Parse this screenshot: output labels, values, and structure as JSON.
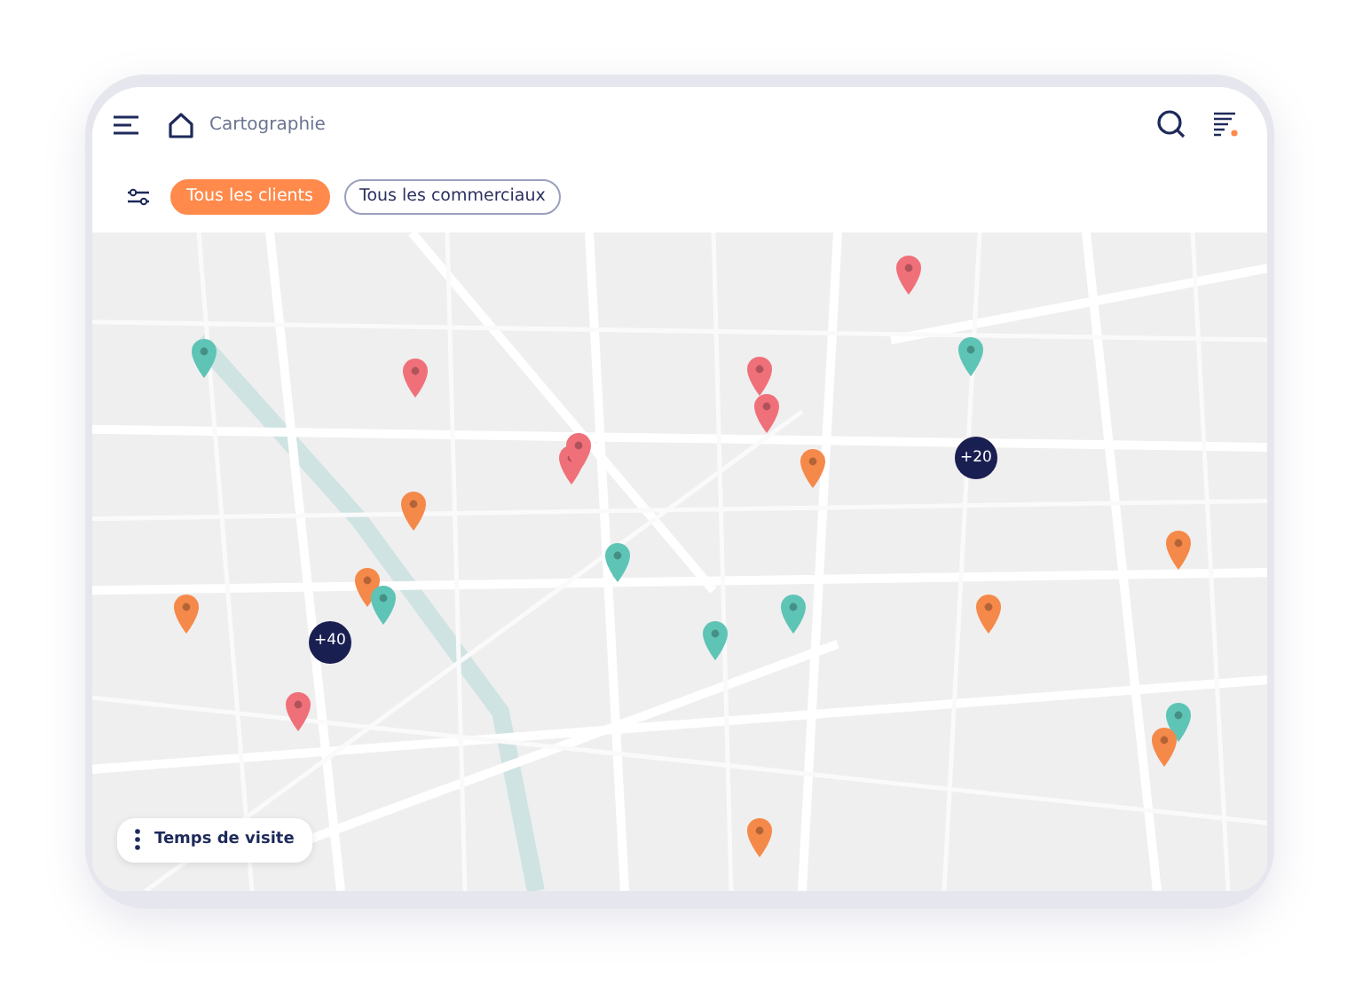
{
  "header": {
    "title": "Cartographie"
  },
  "filters": [
    {
      "label": "Tous les clients",
      "selected": true
    },
    {
      "label": "Tous les commerciaux",
      "selected": false
    }
  ],
  "map": {
    "pins": [
      {
        "color": "#5ec4b6"
      },
      {
        "color": "#f0707a"
      },
      {
        "color": "#f0707a"
      },
      {
        "color": "#f0707a"
      },
      {
        "color": "#f0707a"
      },
      {
        "color": "#5ec4b6"
      },
      {
        "color": "#f0707a"
      },
      {
        "color": "#f0707a"
      },
      {
        "color": "#f5894a"
      },
      {
        "color": "#f5894a"
      },
      {
        "color": "#f5894a"
      },
      {
        "color": "#5ec4b6"
      },
      {
        "color": "#f5894a"
      },
      {
        "color": "#5ec4b6"
      },
      {
        "color": "#5ec4b6"
      },
      {
        "color": "#5ec4b6"
      },
      {
        "color": "#f5894a"
      },
      {
        "color": "#f5894a"
      },
      {
        "color": "#f0707a"
      },
      {
        "color": "#5ec4b6"
      },
      {
        "color": "#f5894a"
      },
      {
        "color": "#f5894a"
      }
    ],
    "clusters": [
      {
        "label": "+40"
      },
      {
        "label": "+20"
      }
    ]
  },
  "visit_time_button": {
    "label": "Temps de visite"
  }
}
